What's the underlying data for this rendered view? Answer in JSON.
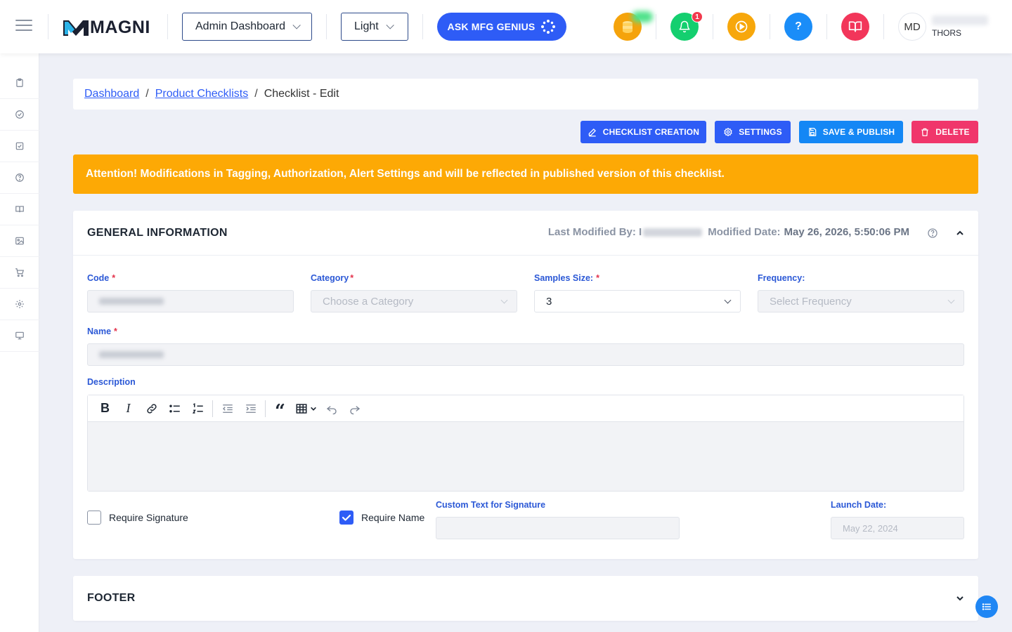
{
  "app": {
    "brand": "MAGNI",
    "dashboard_select": "Admin Dashboard",
    "theme_select": "Light",
    "ask_button": "ASK MFG GENIUS",
    "notification_count": "1",
    "avatar_initials": "MD",
    "user_org": "THORS"
  },
  "sidebar": {
    "items": [
      "clipboard-icon",
      "check-circle-icon",
      "check-square-icon",
      "help-circle-icon",
      "book-icon",
      "image-icon",
      "cart-icon",
      "settings-icon",
      "monitor-icon"
    ]
  },
  "breadcrumb": {
    "items": [
      {
        "label": "Dashboard",
        "link": true
      },
      {
        "label": "Product Checklists",
        "link": true
      },
      {
        "label": "Checklist - Edit",
        "link": false
      }
    ],
    "separator": "/"
  },
  "actions": {
    "checklist_creation": "CHECKLIST CREATION",
    "settings": "SETTINGS",
    "save_publish": "SAVE & PUBLISH",
    "delete": "DELETE"
  },
  "alert": {
    "text": "Attention! Modifications in Tagging, Authorization, Alert Settings and will be reflected in published version of this checklist."
  },
  "general_info": {
    "title": "GENERAL INFORMATION",
    "last_modified_label": "Last Modified By: I",
    "modified_date_label": "Modified Date:",
    "modified_date_value": "May 26, 2026, 5:50:06 PM",
    "code_label": "Code",
    "category_label": "Category",
    "category_placeholder": "Choose a Category",
    "samples_label": "Samples Size:",
    "samples_value": "3",
    "frequency_label": "Frequency:",
    "frequency_placeholder": "Select Frequency",
    "name_label": "Name",
    "description_label": "Description",
    "require_signature_label": "Require Signature",
    "require_name_label": "Require Name",
    "custom_text_label": "Custom Text for Signature",
    "launch_date_label": "Launch Date:",
    "launch_date_value": "May 22, 2024",
    "required_mark": "*"
  },
  "footer_section": {
    "title": "FOOTER"
  },
  "colors": {
    "primary": "#2e5cf6",
    "danger": "#f0366b",
    "warning": "#fda905",
    "label": "#2b58d6"
  }
}
